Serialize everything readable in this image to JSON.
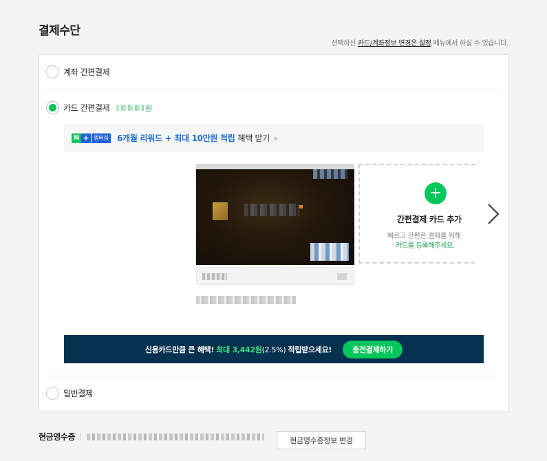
{
  "section_title": "결제수단",
  "notice": {
    "prefix": "선택하신 ",
    "link": "카드/계좌정보 변경은 설정",
    "suffix": " 메뉴에서 하실 수 있습니다."
  },
  "options": {
    "account": {
      "label": "계좌 간편결제",
      "selected": false
    },
    "card": {
      "label": "카드 간편결제",
      "selected": true,
      "amount_suffix": "원"
    },
    "general": {
      "label": "일반결제",
      "selected": false
    }
  },
  "promo": {
    "badge_n": "N",
    "badge_plus": "+",
    "badge_membership": "멤버십",
    "highlight": "6개월 리워드 + 최대 10만원 적립",
    "suffix": "혜택 받기",
    "chevron": "›"
  },
  "add_card": {
    "plus": "+",
    "title": "간편결제 카드 추가",
    "desc_line1": "빠르고 간편한 결제를 위해",
    "desc_line2": "카드를 등록해주세요."
  },
  "cash_banner": {
    "lead": "신용카드만큼 큰 혜택!",
    "highlight": "최대 3,442원",
    "rate": "(2.5%)",
    "tail": "적립받으세요!",
    "button": "충전결제하기"
  },
  "receipt": {
    "label": "현금영수증",
    "button": "현금영수증정보 변경"
  },
  "colors": {
    "accent_green": "#03c75a",
    "link_blue": "#1e6ed8",
    "banner_navy": "#06314f"
  }
}
